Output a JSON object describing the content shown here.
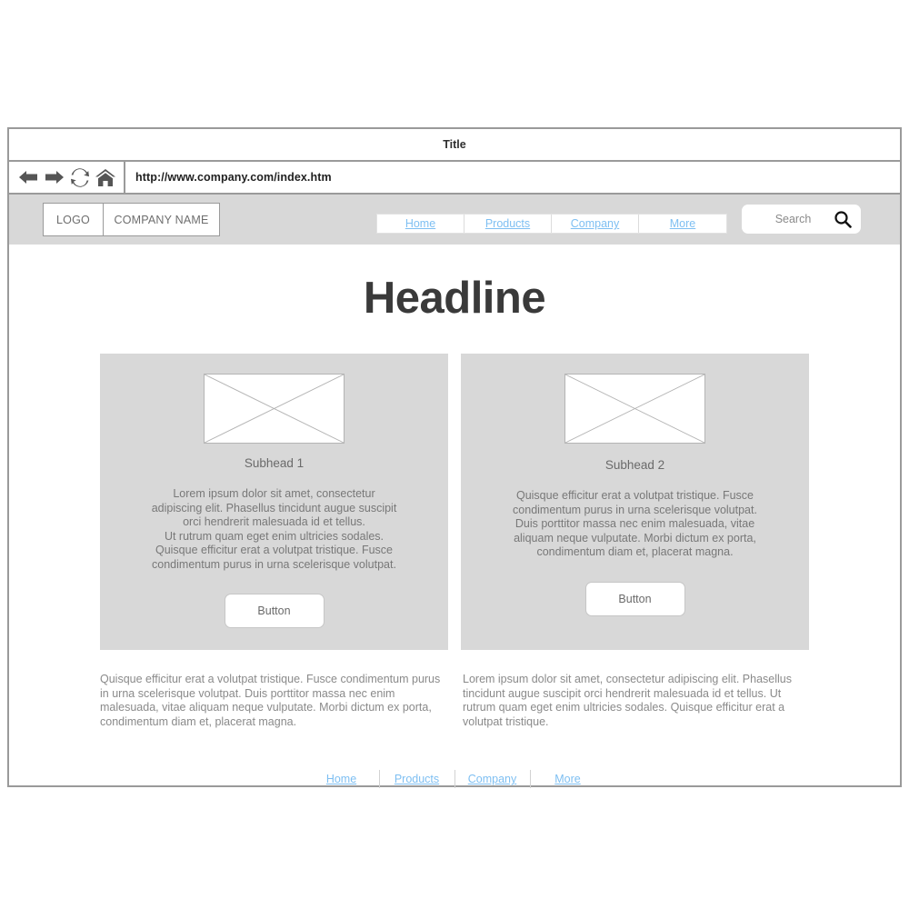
{
  "browser": {
    "title": "Title",
    "url": "http://www.company.com/index.htm",
    "icons": {
      "back": "back-arrow-icon",
      "forward": "forward-arrow-icon",
      "reload": "reload-icon",
      "home": "home-icon"
    }
  },
  "site_nav": {
    "logo_label": "LOGO",
    "company_name": "COMPANY NAME",
    "menu": [
      {
        "label": "Home"
      },
      {
        "label": "Products"
      },
      {
        "label": "Company"
      },
      {
        "label": "More"
      }
    ],
    "search": {
      "placeholder": "Search",
      "icon": "magnifier-icon"
    }
  },
  "page": {
    "headline": "Headline",
    "cards": [
      {
        "image_alt": "image-placeholder",
        "subhead": "Subhead 1",
        "body": "Lorem ipsum dolor sit amet, consectetur\nadipiscing elit. Phasellus tincidunt augue suscipit\norci hendrerit malesuada id et tellus.\nUt rutrum quam eget enim ultricies sodales.\nQuisque efficitur erat a volutpat tristique. Fusce\ncondimentum purus in urna scelerisque volutpat.",
        "button": "Button"
      },
      {
        "image_alt": "image-placeholder",
        "subhead": "Subhead 2",
        "body": "Quisque efficitur erat a volutpat tristique. Fusce\ncondimentum purus in urna scelerisque volutpat.\nDuis porttitor massa nec enim malesuada, vitae\naliquam neque vulputate. Morbi dictum ex porta,\ncondimentum diam et, placerat magna.",
        "button": "Button"
      }
    ],
    "paragraphs": [
      "Quisque efficitur erat a volutpat tristique. Fusce condimentum purus in urna scelerisque volutpat. Duis porttitor massa nec enim malesuada, vitae aliquam neque vulputate. Morbi dictum ex porta, condimentum diam et, placerat magna.",
      "Lorem ipsum dolor sit amet, consectetur adipiscing elit. Phasellus tincidunt augue suscipit orci hendrerit malesuada id et tellus. Ut rutrum quam eget enim ultricies sodales. Quisque efficitur erat a volutpat tristique."
    ],
    "footer_links": [
      {
        "label": "Home"
      },
      {
        "label": "Products"
      },
      {
        "label": "Company"
      },
      {
        "label": "More"
      }
    ]
  },
  "colors": {
    "link": "#7ebff2",
    "band": "#d8d8d8",
    "frame": "#9a9a9a",
    "text": "#8a8a8a",
    "headline": "#3a3a3a"
  }
}
